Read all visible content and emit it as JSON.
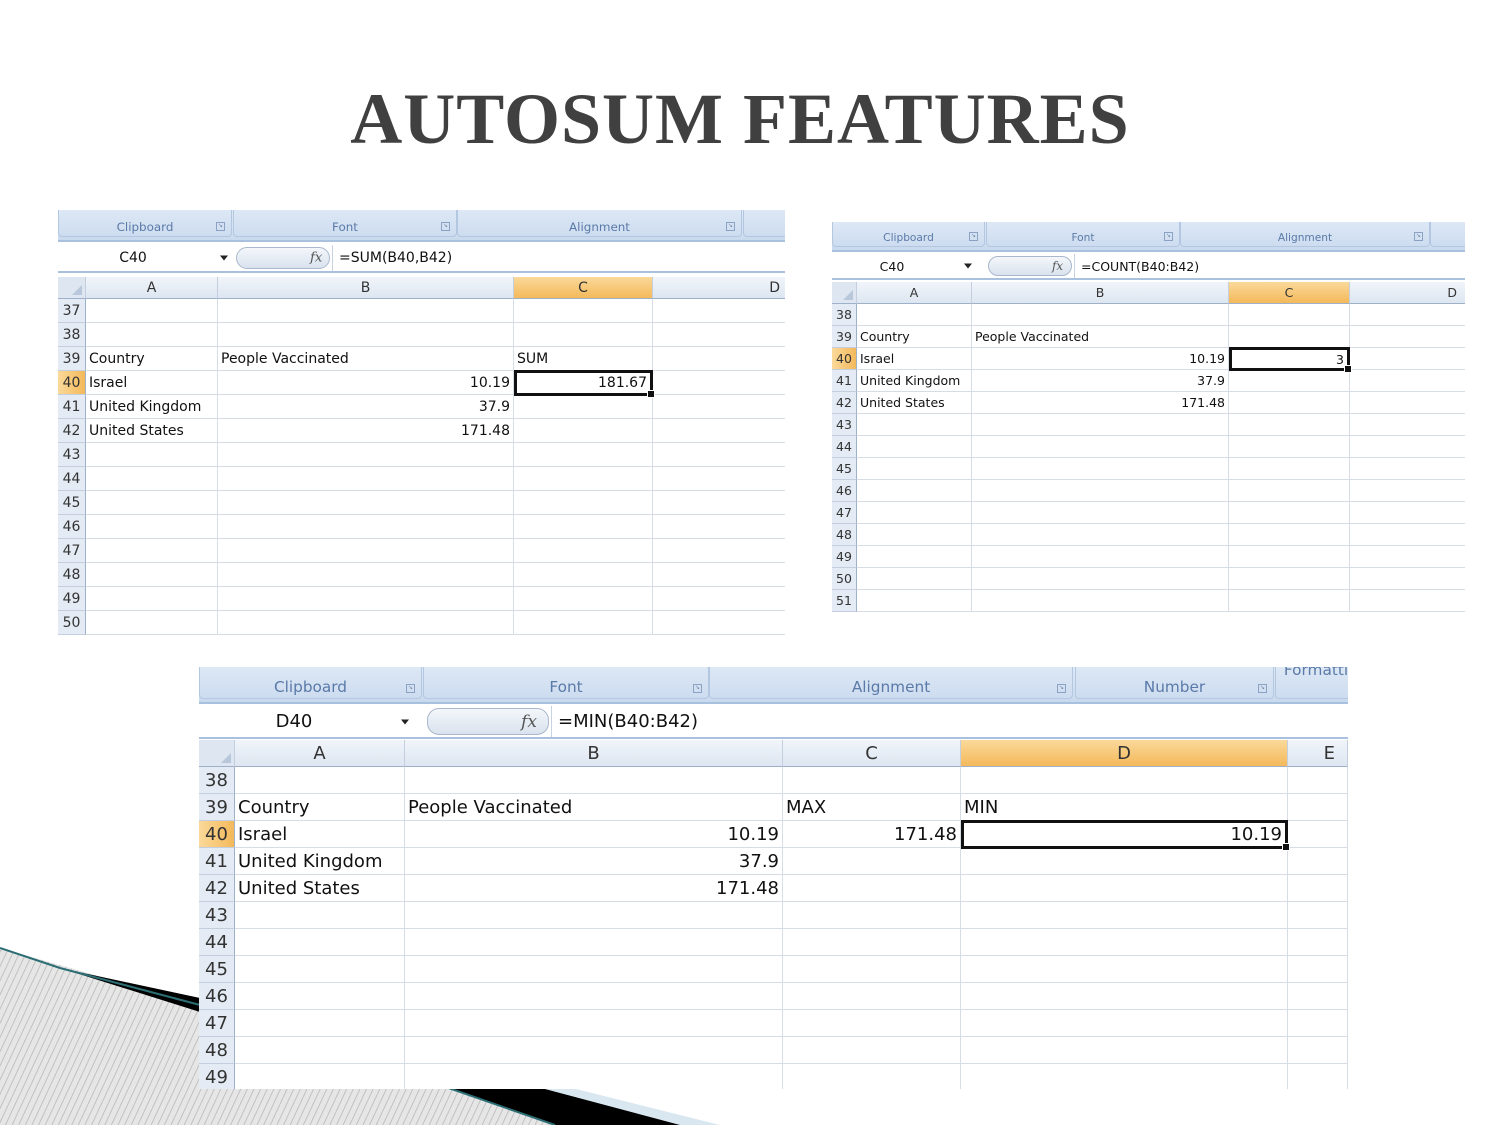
{
  "slide": {
    "title": "AUTOSUM FEATURES"
  },
  "colors": {
    "title": "#404040",
    "selected_header": "#f6c46c",
    "ribbon": "#cddcf0",
    "ribbon_text": "#5a7aa8"
  },
  "sheets": [
    {
      "ribbon_groups": [
        "Clipboard",
        "Font",
        "Alignment",
        ""
      ],
      "name_box": "C40",
      "formula": "=SUM(B40,B42)",
      "columns": [
        "A",
        "B",
        "C",
        "D"
      ],
      "selected_column": "C",
      "selected_row": "40",
      "active_cell": "C40",
      "rows": [
        {
          "n": "37",
          "cells": [
            "",
            "",
            "",
            ""
          ]
        },
        {
          "n": "38",
          "cells": [
            "",
            "",
            "",
            ""
          ]
        },
        {
          "n": "39",
          "cells": [
            "Country",
            "People Vaccinated",
            "SUM",
            ""
          ]
        },
        {
          "n": "40",
          "cells": [
            "Israel",
            "10.19",
            "181.67",
            ""
          ]
        },
        {
          "n": "41",
          "cells": [
            "United Kingdom",
            "37.9",
            "",
            ""
          ]
        },
        {
          "n": "42",
          "cells": [
            "United States",
            "171.48",
            "",
            ""
          ]
        },
        {
          "n": "43",
          "cells": [
            "",
            "",
            "",
            ""
          ]
        },
        {
          "n": "44",
          "cells": [
            "",
            "",
            "",
            ""
          ]
        },
        {
          "n": "45",
          "cells": [
            "",
            "",
            "",
            ""
          ]
        },
        {
          "n": "46",
          "cells": [
            "",
            "",
            "",
            ""
          ]
        },
        {
          "n": "47",
          "cells": [
            "",
            "",
            "",
            ""
          ]
        },
        {
          "n": "48",
          "cells": [
            "",
            "",
            "",
            ""
          ]
        },
        {
          "n": "49",
          "cells": [
            "",
            "",
            "",
            ""
          ]
        },
        {
          "n": "50",
          "cells": [
            "",
            "",
            "",
            ""
          ]
        }
      ]
    },
    {
      "ribbon_groups": [
        "Clipboard",
        "Font",
        "Alignment",
        ""
      ],
      "name_box": "C40",
      "formula": "=COUNT(B40:B42)",
      "columns": [
        "A",
        "B",
        "C",
        "D"
      ],
      "selected_column": "C",
      "selected_row": "40",
      "active_cell": "C40",
      "rows": [
        {
          "n": "38",
          "cells": [
            "",
            "",
            "",
            ""
          ]
        },
        {
          "n": "39",
          "cells": [
            "Country",
            "People Vaccinated",
            "",
            ""
          ]
        },
        {
          "n": "40",
          "cells": [
            "Israel",
            "10.19",
            "3",
            ""
          ]
        },
        {
          "n": "41",
          "cells": [
            "United Kingdom",
            "37.9",
            "",
            ""
          ]
        },
        {
          "n": "42",
          "cells": [
            "United States",
            "171.48",
            "",
            ""
          ]
        },
        {
          "n": "43",
          "cells": [
            "",
            "",
            "",
            ""
          ]
        },
        {
          "n": "44",
          "cells": [
            "",
            "",
            "",
            ""
          ]
        },
        {
          "n": "45",
          "cells": [
            "",
            "",
            "",
            ""
          ]
        },
        {
          "n": "46",
          "cells": [
            "",
            "",
            "",
            ""
          ]
        },
        {
          "n": "47",
          "cells": [
            "",
            "",
            "",
            ""
          ]
        },
        {
          "n": "48",
          "cells": [
            "",
            "",
            "",
            ""
          ]
        },
        {
          "n": "49",
          "cells": [
            "",
            "",
            "",
            ""
          ]
        },
        {
          "n": "50",
          "cells": [
            "",
            "",
            "",
            ""
          ]
        },
        {
          "n": "51",
          "cells": [
            "",
            "",
            "",
            ""
          ]
        }
      ]
    },
    {
      "ribbon_groups": [
        "Clipboard",
        "Font",
        "Alignment",
        "Number",
        "Formatti"
      ],
      "name_box": "D40",
      "formula": "=MIN(B40:B42)",
      "columns": [
        "A",
        "B",
        "C",
        "D",
        "E"
      ],
      "selected_column": "D",
      "selected_row": "40",
      "active_cell": "D40",
      "rows": [
        {
          "n": "38",
          "cells": [
            "",
            "",
            "",
            "",
            ""
          ]
        },
        {
          "n": "39",
          "cells": [
            "Country",
            "People Vaccinated",
            "MAX",
            "MIN",
            ""
          ]
        },
        {
          "n": "40",
          "cells": [
            "Israel",
            "10.19",
            "171.48",
            "10.19",
            ""
          ]
        },
        {
          "n": "41",
          "cells": [
            "United Kingdom",
            "37.9",
            "",
            "",
            ""
          ]
        },
        {
          "n": "42",
          "cells": [
            "United States",
            "171.48",
            "",
            "",
            ""
          ]
        },
        {
          "n": "43",
          "cells": [
            "",
            "",
            "",
            "",
            ""
          ]
        },
        {
          "n": "44",
          "cells": [
            "",
            "",
            "",
            "",
            ""
          ]
        },
        {
          "n": "45",
          "cells": [
            "",
            "",
            "",
            "",
            ""
          ]
        },
        {
          "n": "46",
          "cells": [
            "",
            "",
            "",
            "",
            ""
          ]
        },
        {
          "n": "47",
          "cells": [
            "",
            "",
            "",
            "",
            ""
          ]
        },
        {
          "n": "48",
          "cells": [
            "",
            "",
            "",
            "",
            ""
          ]
        },
        {
          "n": "49",
          "cells": [
            "",
            "",
            "",
            "",
            ""
          ]
        }
      ]
    }
  ]
}
